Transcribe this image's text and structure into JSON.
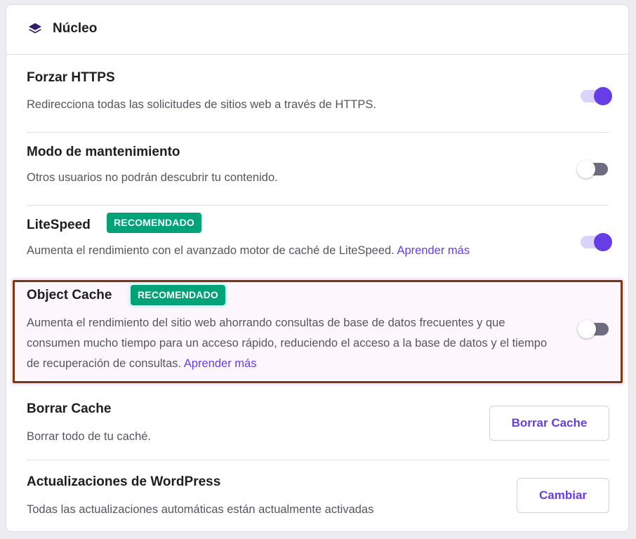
{
  "section": {
    "title": "Núcleo",
    "icon": "layers-icon"
  },
  "settings": [
    {
      "title": "Forzar HTTPS",
      "description": "Redirecciona todas las solicitudes de sitios web a través de HTTPS.",
      "toggle_on": true
    },
    {
      "title": "Modo de mantenimiento",
      "description": "Otros usuarios no podrán descubrir tu contenido.",
      "toggle_on": false
    },
    {
      "title": "LiteSpeed",
      "badge": "RECOMENDADO",
      "description": "Aumenta el rendimiento con el avanzado motor de caché de LiteSpeed.",
      "link": "Aprender más",
      "toggle_on": true
    },
    {
      "title": "Object Cache",
      "badge": "RECOMENDADO",
      "description": "Aumenta el rendimiento del sitio web ahorrando consultas de base de datos frecuentes y que consumen mucho tiempo para un acceso rápido, reduciendo el acceso a la base de datos y el tiempo de recuperación de consultas.",
      "link": "Aprender más",
      "toggle_on": false
    },
    {
      "title": "Borrar Cache",
      "description": "Borrar todo de tu caché.",
      "button": "Borrar Cache"
    },
    {
      "title": "Actualizaciones de WordPress",
      "description": "Todas las actualizaciones automáticas están actualmente activadas",
      "button": "Cambiar"
    }
  ],
  "colors": {
    "accent": "#673de6",
    "badge": "#00a378",
    "highlight_border": "#7a3812"
  }
}
